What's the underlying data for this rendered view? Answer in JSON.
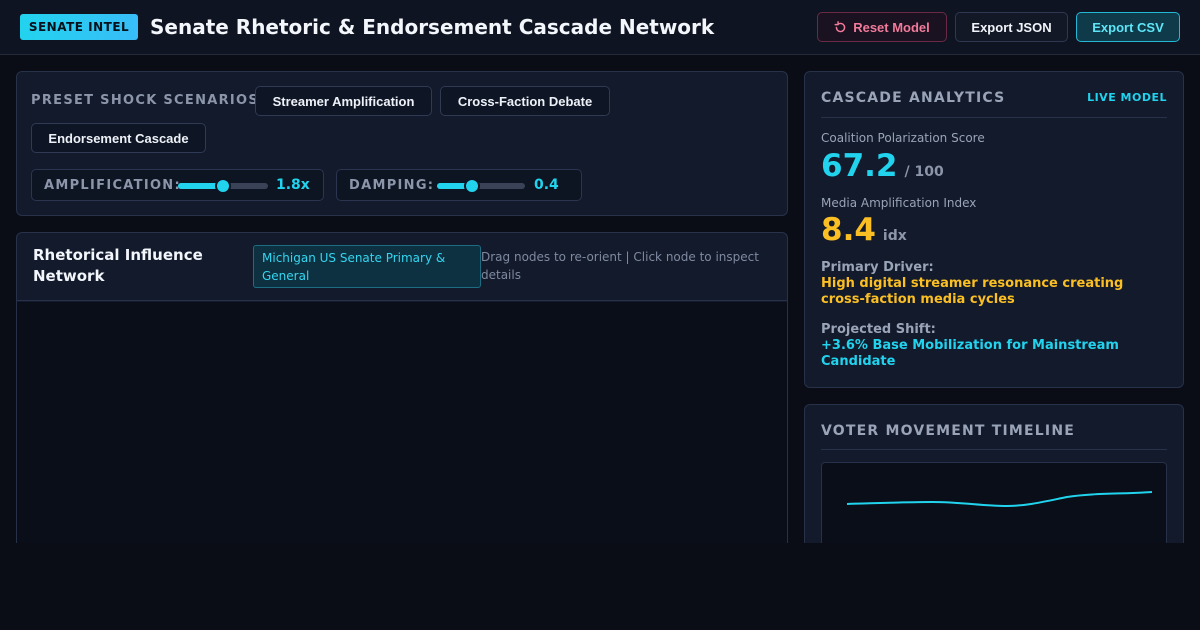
{
  "header": {
    "brand": "SENATE INTEL",
    "title": "Senate Rhetoric & Endorsement Cascade Network",
    "reset_label": "Reset Model",
    "reset_icon": "reset-icon",
    "export_json_label": "Export JSON",
    "export_csv_label": "Export CSV"
  },
  "controls": {
    "preset_label": "PRESET SHOCK SCENARIOS:",
    "presets": [
      "Streamer Amplification",
      "Cross-Faction Debate",
      "Endorsement Cascade"
    ],
    "amplification": {
      "label": "AMPLIFICATION:",
      "value": "1.8x",
      "level": 0.5
    },
    "damping": {
      "label": "DAMPING:",
      "value": "0.4",
      "level": 0.4
    }
  },
  "network": {
    "title": "Rhetorical Influence Network",
    "context": "Michigan US Senate Primary & General",
    "hint": "Drag nodes to re-orient | Click node to inspect details"
  },
  "analytics": {
    "title": "CASCADE ANALYTICS",
    "badge": "LIVE MODEL",
    "polarization": {
      "label": "Coalition Polarization Score",
      "value": "67.2",
      "unit": "/ 100"
    },
    "amplification_index": {
      "label": "Media Amplification Index",
      "value": "8.4",
      "unit": "idx"
    },
    "primary_driver": {
      "label": "Primary Driver:",
      "text": "High digital streamer resonance creating cross-faction media cycles"
    },
    "projected_shift": {
      "label": "Projected Shift:",
      "text": "+3.6% Base Mobilization for Mainstream Candidate"
    }
  },
  "timeline": {
    "title": "VOTER MOVEMENT TIMELINE",
    "line_color": "#22d3ee"
  },
  "colors": {
    "accent": "#22d3ee",
    "warning": "#fbbf24",
    "danger": "#f27a9a",
    "background": "#0a0d16"
  }
}
